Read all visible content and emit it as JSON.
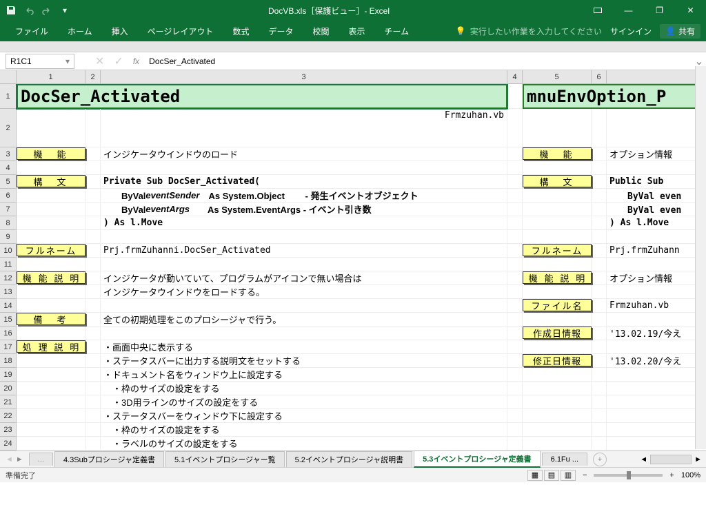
{
  "title": "DocVB.xls［保護ビュー］- Excel",
  "qat": {
    "save": "save",
    "undo": "undo",
    "redo": "redo"
  },
  "win": {
    "restore_small": "❐",
    "min": "—",
    "restore": "❐",
    "close": "✕"
  },
  "tabs": [
    "ファイル",
    "ホーム",
    "挿入",
    "ページレイアウト",
    "数式",
    "データ",
    "校閲",
    "表示",
    "チーム"
  ],
  "tellme": "実行したい作業を入力してください",
  "signin": "サインイン",
  "share": "共有",
  "namebox": "R1C1",
  "formula": "DocSer_Activated",
  "cols": [
    "1",
    "2",
    "3",
    "4",
    "5",
    "6"
  ],
  "rows": [
    "1",
    "2",
    "3",
    "4",
    "5",
    "6",
    "7",
    "8",
    "9",
    "10",
    "11",
    "12",
    "13",
    "14",
    "15",
    "16",
    "17",
    "18",
    "19",
    "20",
    "21",
    "22",
    "23",
    "24"
  ],
  "cell": {
    "title_left": "DocSer_Activated",
    "title_right": "mnuEnvOption_P",
    "file_l": "Frmzuhan.vb",
    "lbl_kinou": "機　能",
    "kinou_l": "インジケータウインドウのロード",
    "kinou_r": "オプション情報",
    "lbl_koubun": "構　文",
    "koubun_l1": "Private Sub DocSer_Activated(",
    "koubun_l2a": "　　ByVal ",
    "koubun_l2b": "eventSender",
    "koubun_l2c": "　As System.Object　　 - 発生イベントオブジェクト",
    "koubun_l3a": "　　ByVal ",
    "koubun_l3b": "eventArgs",
    "koubun_l3c": "　　As System.EventArgs - イベント引き数",
    "koubun_l4": ") As l.Move",
    "koubun_r1": "Public Sub ",
    "koubun_r2": "　　ByVal even",
    "koubun_r3": "　　ByVal even",
    "koubun_r4": ") As l.Move",
    "lbl_full": "フルネーム",
    "full_l": "Prj.frmZuhanni.DocSer_Activated",
    "full_r": "Prj.frmZuhann",
    "lbl_setsumei": "機 能 説 明",
    "setsumei_l1": "インジケータが動いていて、プログラムがアイコンで無い場合は",
    "setsumei_l2": "インジケータウインドウをロードする。",
    "setsumei_r": "オプション情報",
    "lbl_file": "ファイル名",
    "file_r": "Frmzuhan.vb",
    "lbl_bikou": "備　考",
    "bikou_l": "全ての初期処理をこのプロシージャで行う。",
    "lbl_sakusei": "作成日情報",
    "sakusei_r": "'13.02.19/今え",
    "lbl_shori": "処 理 説 明",
    "shori_1": "・画面中央に表示する",
    "lbl_shusei": "修正日情報",
    "shusei_r": "'13.02.20/今え",
    "shori_2": "・ステータスバーに出力する説明文をセットする",
    "shori_3": "・ドキュメント名をウィンドウ上に設定する",
    "shori_4": "　・枠のサイズの設定をする",
    "shori_5": "　・3D用ラインのサイズの設定をする",
    "shori_6": "・ステータスバーをウィンドウ下に設定する",
    "shori_7": "　・枠のサイズの設定をする",
    "shori_8": "　・ラベルのサイズの設定をする"
  },
  "sheets": {
    "ellipsis": "...",
    "t1": "4.3Subプロシージャ定義書",
    "t2": "5.1イベントプロシージャー覧",
    "t3": "5.2イベントプロシージャ説明書",
    "t4": "5.3イベントプロシージャ定義書",
    "t5": "6.1Fu ...",
    "new": "+"
  },
  "status": {
    "ready": "準備完了",
    "zoom": "100%"
  }
}
